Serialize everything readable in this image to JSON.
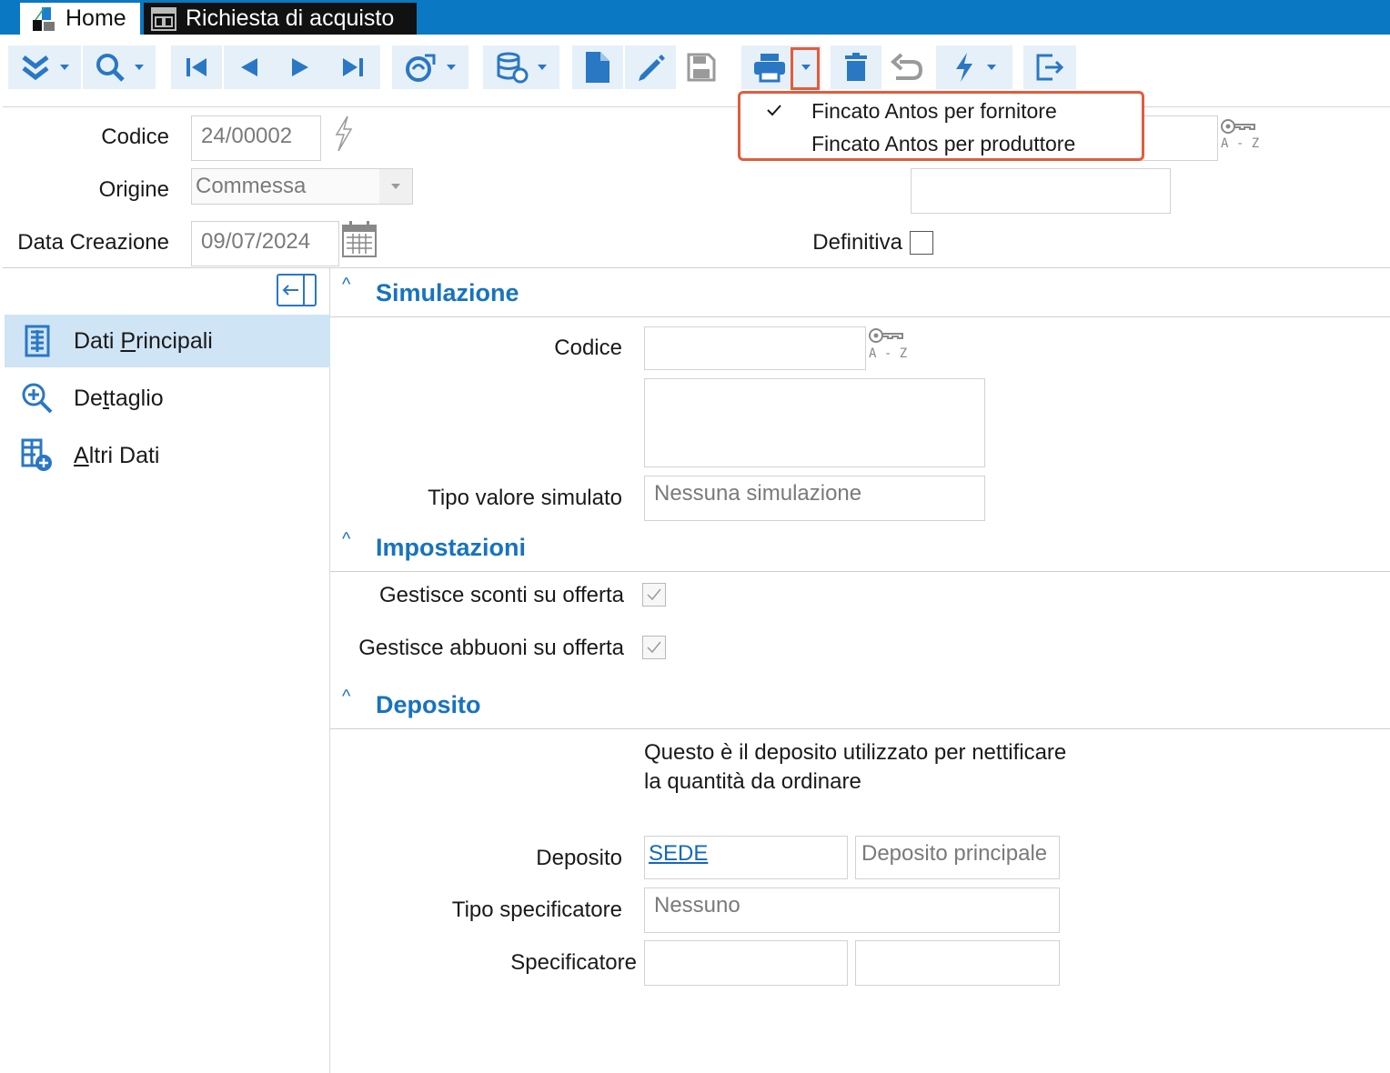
{
  "tabs": {
    "home": "Home",
    "active": "Richiesta di acquisto"
  },
  "header": {
    "codice_label": "Codice",
    "codice_value": "24/00002",
    "origine_label": "Origine",
    "origine_value": "Commessa",
    "data_creazione_label": "Data Creazione",
    "data_creazione_value": "09/07/2024",
    "definitiva_label": "Definitiva",
    "az_label": "A - Z"
  },
  "print_menu": {
    "items": [
      "Fincato Antos per fornitore",
      "Fincato Antos per produttore"
    ],
    "checked_index": 0
  },
  "nav": {
    "items": [
      {
        "label": "Dati Principali",
        "mnemonic": "P"
      },
      {
        "label": "Dettaglio",
        "mnemonic": "t"
      },
      {
        "label": "Altri Dati",
        "mnemonic": "A"
      }
    ],
    "selected_index": 0
  },
  "simulazione": {
    "title": "Simulazione",
    "codice_label": "Codice",
    "az_label": "A - Z",
    "tipo_label": "Tipo valore simulato",
    "tipo_value": "Nessuna simulazione"
  },
  "impostazioni": {
    "title": "Impostazioni",
    "sconti_label": "Gestisce sconti su offerta",
    "abbuoni_label": "Gestisce abbuoni su offerta"
  },
  "deposito": {
    "title": "Deposito",
    "description_line1": "Questo è il deposito utilizzato per nettificare",
    "description_line2": "la quantità da ordinare",
    "deposito_label": "Deposito",
    "deposito_code": "SEDE",
    "deposito_desc": "Deposito principale",
    "tipo_spec_label": "Tipo specificatore",
    "tipo_spec_value": "Nessuno",
    "specificatore_label": "Specificatore"
  },
  "colors": {
    "accent": "#0a78c3",
    "section": "#1873bf",
    "highlight": "#e25c3c",
    "nav_selected": "#cfe4f5"
  }
}
